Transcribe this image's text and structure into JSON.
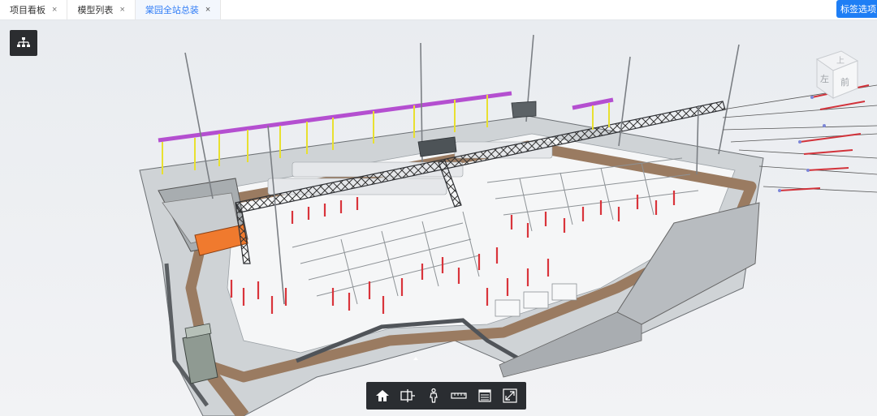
{
  "tabs": [
    {
      "label": "项目看板",
      "close": "×"
    },
    {
      "label": "模型列表",
      "close": "×"
    },
    {
      "label": "棠园全站总装",
      "close": "×"
    }
  ],
  "active_tab": 2,
  "header": {
    "tag_options_label": "标签选项"
  },
  "viewcube": {
    "top_label": "上",
    "left_label": "左",
    "front_label": "前"
  },
  "toolbar": {
    "items": [
      "home-icon",
      "section-plane-icon",
      "walk-person-icon",
      "measure-ruler-icon",
      "properties-list-icon",
      "fullscreen-icon"
    ]
  },
  "colors": {
    "accent": "#1e7ef5",
    "active_tab_text": "#2f7cf6",
    "toolbar_bg": "#2a2d31"
  }
}
